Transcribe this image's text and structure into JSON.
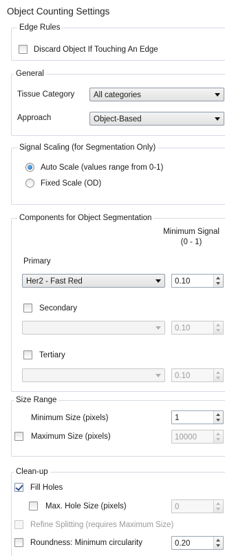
{
  "title": "Object Counting Settings",
  "edge_rules": {
    "label": "Edge Rules",
    "discard_label": "Discard Object If Touching An Edge",
    "discard_checked": false
  },
  "general": {
    "label": "General",
    "tissue_label": "Tissue Category",
    "tissue_value": "All categories",
    "approach_label": "Approach",
    "approach_value": "Object-Based"
  },
  "signal_scaling": {
    "label": "Signal Scaling (for Segmentation Only)",
    "auto_label": "Auto Scale (values range from 0-1)",
    "fixed_label": "Fixed Scale (OD)",
    "selected": "auto"
  },
  "components": {
    "label": "Components for Object Segmentation",
    "min_signal_header_line1": "Minimum Signal",
    "min_signal_header_line2": "(0 - 1)",
    "primary_label": "Primary",
    "primary_value": "Her2 - Fast Red",
    "primary_min": "0.10",
    "secondary_label": "Secondary",
    "secondary_value": "",
    "secondary_min": "0.10",
    "tertiary_label": "Tertiary",
    "tertiary_value": "",
    "tertiary_min": "0.10"
  },
  "size_range": {
    "label": "Size Range",
    "min_label": "Minimum Size (pixels)",
    "min_value": "1",
    "max_label": "Maximum Size (pixels)",
    "max_value": "10000"
  },
  "cleanup": {
    "label": "Clean-up",
    "fill_holes_label": "Fill Holes",
    "max_hole_label": "Max. Hole Size (pixels)",
    "max_hole_value": "0",
    "refine_label": "Refine Splitting (requires Maximum Size)",
    "roundness_label": "Roundness: Minimum circularity",
    "roundness_value": "0.20"
  }
}
